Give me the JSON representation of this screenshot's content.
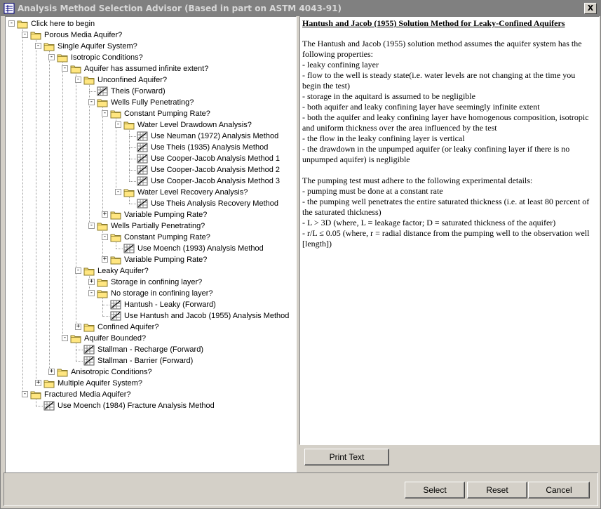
{
  "window": {
    "title": "Analysis Method Selection Advisor (Based in part on ASTM 4043-91)",
    "close_glyph": "X"
  },
  "tree": [
    {
      "label": "Click here to begin",
      "level": 0,
      "expander": "-",
      "icon": "folder"
    },
    {
      "label": "Porous Media Aquifer?",
      "level": 1,
      "expander": "-",
      "icon": "folder"
    },
    {
      "label": "Single Aquifer System?",
      "level": 2,
      "expander": "-",
      "icon": "folder"
    },
    {
      "label": "Isotropic Conditions?",
      "level": 3,
      "expander": "-",
      "icon": "folder"
    },
    {
      "label": "Aquifer has assumed infinite extent?",
      "level": 4,
      "expander": "-",
      "icon": "folder"
    },
    {
      "label": "Unconfined Aquifer?",
      "level": 5,
      "expander": "-",
      "icon": "folder"
    },
    {
      "label": "Theis (Forward)",
      "level": 6,
      "expander": "",
      "icon": "method"
    },
    {
      "label": "Wells Fully Penetrating?",
      "level": 6,
      "expander": "-",
      "icon": "folder"
    },
    {
      "label": "Constant Pumping Rate?",
      "level": 7,
      "expander": "-",
      "icon": "folder"
    },
    {
      "label": "Water Level Drawdown Analysis?",
      "level": 8,
      "expander": "-",
      "icon": "folder"
    },
    {
      "label": "Use Neuman (1972) Analysis Method",
      "level": 9,
      "expander": "",
      "icon": "method"
    },
    {
      "label": "Use Theis (1935) Analysis Method",
      "level": 9,
      "expander": "",
      "icon": "method"
    },
    {
      "label": "Use Cooper-Jacob Analysis Method 1",
      "level": 9,
      "expander": "",
      "icon": "method"
    },
    {
      "label": "Use Cooper-Jacob Analysis Method 2",
      "level": 9,
      "expander": "",
      "icon": "method"
    },
    {
      "label": "Use Cooper-Jacob Analysis Method 3",
      "level": 9,
      "expander": "",
      "icon": "method"
    },
    {
      "label": "Water Level Recovery Analysis?",
      "level": 8,
      "expander": "-",
      "icon": "folder"
    },
    {
      "label": "Use Theis Analysis Recovery Method",
      "level": 9,
      "expander": "",
      "icon": "method"
    },
    {
      "label": "Variable Pumping Rate?",
      "level": 7,
      "expander": "+",
      "icon": "folder"
    },
    {
      "label": "Wells Partially Penetrating?",
      "level": 6,
      "expander": "-",
      "icon": "folder"
    },
    {
      "label": "Constant Pumping Rate?",
      "level": 7,
      "expander": "-",
      "icon": "folder"
    },
    {
      "label": "Use Moench (1993) Analysis Method",
      "level": 8,
      "expander": "",
      "icon": "method"
    },
    {
      "label": "Variable Pumping Rate?",
      "level": 7,
      "expander": "+",
      "icon": "folder"
    },
    {
      "label": "Leaky Aquifer?",
      "level": 5,
      "expander": "-",
      "icon": "folder"
    },
    {
      "label": "Storage in confining layer?",
      "level": 6,
      "expander": "+",
      "icon": "folder"
    },
    {
      "label": "No storage in confining layer?",
      "level": 6,
      "expander": "-",
      "icon": "folder"
    },
    {
      "label": "Hantush - Leaky (Forward)",
      "level": 7,
      "expander": "",
      "icon": "method"
    },
    {
      "label": "Use Hantush and Jacob (1955) Analysis Method",
      "level": 7,
      "expander": "",
      "icon": "method"
    },
    {
      "label": "Confined Aquifer?",
      "level": 5,
      "expander": "+",
      "icon": "folder"
    },
    {
      "label": "Aquifer Bounded?",
      "level": 4,
      "expander": "-",
      "icon": "folder"
    },
    {
      "label": "Stallman - Recharge (Forward)",
      "level": 5,
      "expander": "",
      "icon": "method"
    },
    {
      "label": "Stallman - Barrier (Forward)",
      "level": 5,
      "expander": "",
      "icon": "method"
    },
    {
      "label": "Anisotropic Conditions?",
      "level": 3,
      "expander": "+",
      "icon": "folder"
    },
    {
      "label": "Multiple Aquifer System?",
      "level": 2,
      "expander": "+",
      "icon": "folder"
    },
    {
      "label": "Fractured Media Aquifer?",
      "level": 1,
      "expander": "-",
      "icon": "folder"
    },
    {
      "label": "Use Moench (1984) Fracture Analysis Method",
      "level": 2,
      "expander": "",
      "icon": "method"
    }
  ],
  "description": {
    "heading": "Hantush and Jacob (1955) Solution Method for Leaky-Confined Aquifers",
    "paragraphs": [
      "The Hantush and Jacob (1955) solution method assumes the aquifer system has the following properties:",
      "- leaky confining layer",
      "- flow to the well is steady state(i.e. water levels are not changing at the time you begin the test)",
      "- storage in  the aquitard is assumed to be negligible",
      "- both aquifer and leaky confining layer have seemingly infinite extent",
      "- both the aquifer and leaky confining layer have homogenous composition, isotropic and uniform thickness over the area influenced by the test",
      "- the flow in the leaky confining layer is vertical",
      "- the drawdown in the unpumped aquifer (or leaky confining layer if there is no unpumped aquifer) is negligible",
      "",
      "The pumping test must adhere to the following experimental details:",
      "- pumping must be done at a constant rate",
      "- the pumping well penetrates the entire saturated thickness (i.e. at least 80 percent of the saturated thickness)",
      "- L > 3D (where, L = leakage factor; D = saturated thickness of the aquifer)",
      "- r/L ≤ 0.05 (where, r = radial distance from the pumping well to the observation well [length])"
    ]
  },
  "buttons": {
    "print_text": "Print Text",
    "select": "Select",
    "reset": "Reset",
    "cancel": "Cancel"
  },
  "colors": {
    "face": "#d4d0c8",
    "folder": "#ffe680",
    "folder_edge": "#8a7a2a",
    "title_bg": "#808080"
  }
}
